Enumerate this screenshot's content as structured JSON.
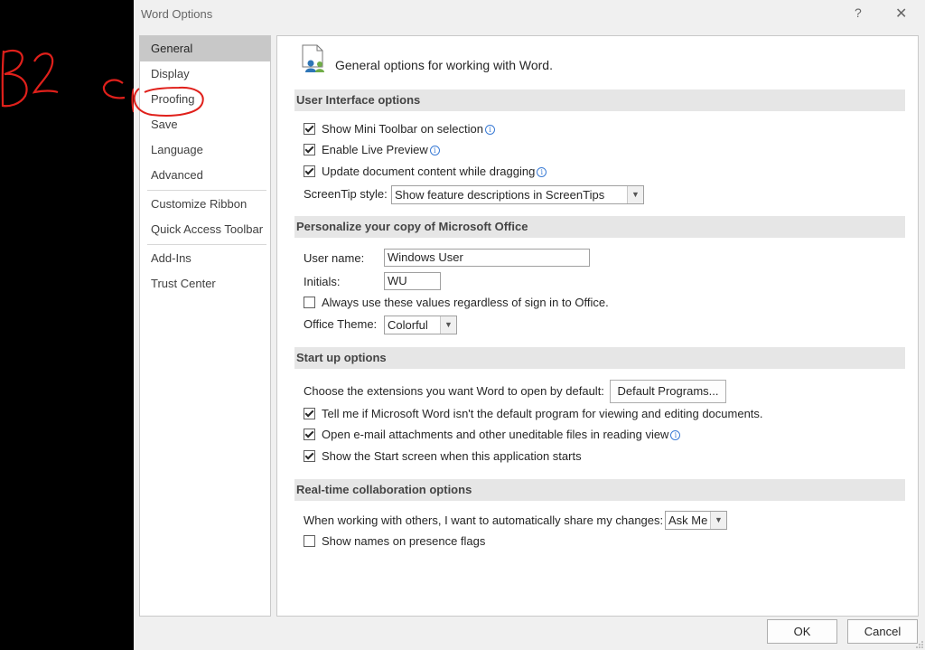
{
  "annotation": {
    "text": "B2"
  },
  "dialog": {
    "title": "Word Options",
    "help_glyph": "?",
    "close_glyph": "✕"
  },
  "nav": {
    "items": [
      {
        "label": "General",
        "active": true
      },
      {
        "label": "Display"
      },
      {
        "label": "Proofing"
      },
      {
        "label": "Save"
      },
      {
        "label": "Language"
      },
      {
        "label": "Advanced"
      },
      {
        "label": "Customize Ribbon"
      },
      {
        "label": "Quick Access Toolbar"
      },
      {
        "label": "Add-Ins"
      },
      {
        "label": "Trust Center"
      }
    ]
  },
  "page": {
    "heading": "General options for working with Word."
  },
  "ui_options": {
    "header": "User Interface options",
    "mini_toolbar": "Show Mini Toolbar on selection",
    "live_preview": "Enable Live Preview",
    "update_dragging": "Update document content while dragging",
    "screentip_label": "ScreenTip style:",
    "screentip_value": "Show feature descriptions in ScreenTips"
  },
  "personalize": {
    "header": "Personalize your copy of Microsoft Office",
    "username_label": "User name:",
    "username_value": "Windows User",
    "initials_label": "Initials:",
    "initials_value": "WU",
    "always_use": "Always use these values regardless of sign in to Office.",
    "theme_label": "Office Theme:",
    "theme_value": "Colorful"
  },
  "startup": {
    "header": "Start up options",
    "extensions_label": "Choose the extensions you want Word to open by default:",
    "default_programs": "Default Programs...",
    "tell_me": "Tell me if Microsoft Word isn't the default program for viewing and editing documents.",
    "open_email": "Open e-mail attachments and other uneditable files in reading view",
    "show_start": "Show the Start screen when this application starts"
  },
  "collab": {
    "header": "Real-time collaboration options",
    "share_label": "When working with others, I want to automatically share my changes:",
    "share_value": "Ask Me",
    "presence_flags": "Show names on presence flags"
  },
  "footer": {
    "ok": "OK",
    "cancel": "Cancel"
  },
  "colors": {
    "annotation": "#e0201b",
    "selected_nav": "#c8c8c8",
    "section_bg": "#e6e6e6",
    "info_blue": "#3a7bd5"
  },
  "icons": [
    "info-icon",
    "help-icon",
    "close-icon",
    "chevron-down-icon",
    "general-options-icon",
    "resize-grip-icon"
  ]
}
